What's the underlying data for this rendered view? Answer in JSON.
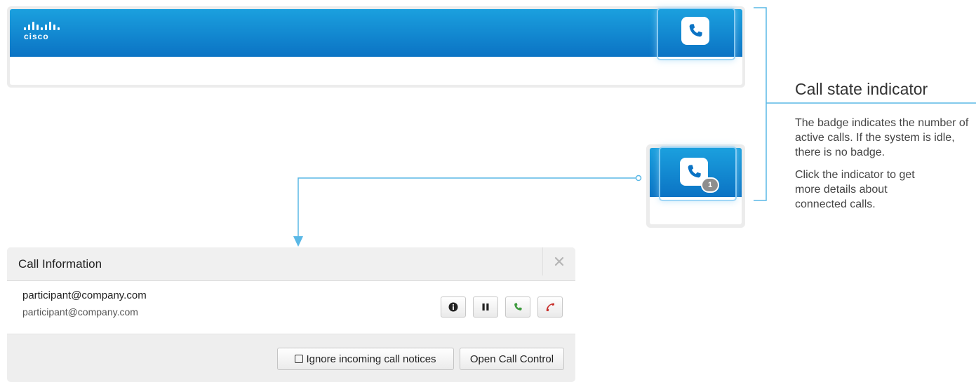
{
  "header": {
    "logo_text": "cisco",
    "call_icon": "phone-icon"
  },
  "indicator_active": {
    "call_icon": "phone-icon",
    "badge_count": "1"
  },
  "callout": {
    "title": "Call state indicator",
    "paragraphs": [
      "The badge indicates the number of active calls. If the system is idle, there is no badge.",
      "Click the indicator to get more details about connected calls."
    ]
  },
  "dialog": {
    "title": "Call Information",
    "close_icon": "close-icon",
    "participant": {
      "name": "participant@company.com",
      "uri": "participant@company.com"
    },
    "actions": [
      {
        "icon": "info-icon"
      },
      {
        "icon": "pause-icon"
      },
      {
        "icon": "resume-call-icon"
      },
      {
        "icon": "hang-up-icon"
      }
    ],
    "ignore_label": "Ignore incoming call notices",
    "open_label": "Open Call Control"
  },
  "colors": {
    "bar_top": "#1ba0de",
    "bar_bottom": "#0b73c4",
    "accent_line": "#5ab8e6",
    "call_green": "#3d9a3d",
    "hangup_red": "#c8312d",
    "badge_gray": "#8e8e8e"
  }
}
